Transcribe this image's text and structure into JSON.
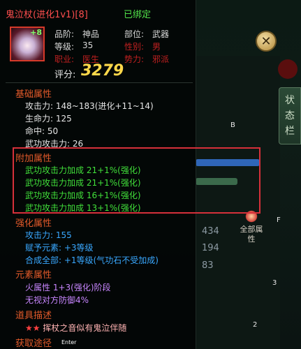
{
  "item": {
    "name": "鬼泣杖(进化1v1)[8]",
    "bound": "已绑定",
    "icon_level": "+8",
    "quality_label": "品阶:",
    "quality": "神品",
    "slot_label": "部位:",
    "slot": "武器",
    "level_label": "等级:",
    "level": "35",
    "gender_label": "性别:",
    "gender": "男",
    "job_label": "职业:",
    "job": "医生",
    "faction_label": "势力:",
    "faction": "邪派",
    "score_label": "评分:",
    "score": "3279"
  },
  "base": {
    "title": "基础属性",
    "attack": "攻击力: 148~183(进化+11~14)",
    "hp": "生命力: 125",
    "hit": "命中: 50",
    "martial_attack": "武功攻击力: 26"
  },
  "extra": {
    "title": "附加属性",
    "lines": [
      "武功攻击力加成 21+1%(强化)",
      "武功攻击力加成 21+1%(强化)",
      "武功攻击力加成 16+1%(强化)",
      "武功攻击力加成 13+1%(强化)"
    ]
  },
  "enhance": {
    "title": "强化属性",
    "attack": "攻击力: 155",
    "element": "赋予元素: +3等级",
    "synthesis": "合成全部: +1等级(气功石不受加成)"
  },
  "element": {
    "title": "元素属性",
    "fire": "火属性 1+3(强化)阶段",
    "ignore": "无视对方防御4%"
  },
  "desc": {
    "title": "道具描述",
    "stars": "★★",
    "text": "挥杖之音似有鬼泣伴随"
  },
  "source": {
    "title": "获取途径",
    "enter": "Enter"
  },
  "background": {
    "side_tab": [
      "状",
      "态",
      "栏"
    ],
    "close_glyph": "✕",
    "all_attr": "全部属性",
    "numbers": [
      "434",
      "194",
      "83"
    ],
    "letters": [
      "B",
      "F",
      "3",
      "2"
    ]
  }
}
